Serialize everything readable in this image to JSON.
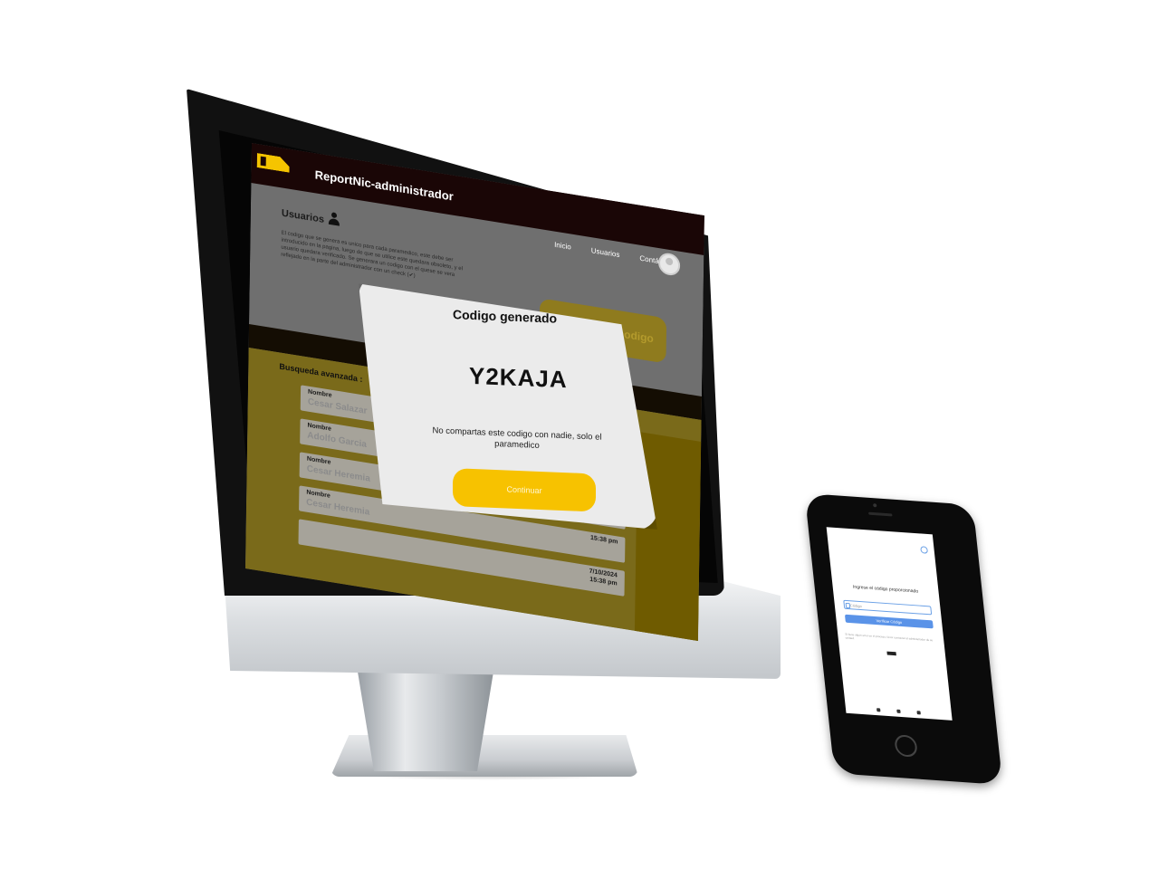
{
  "app": {
    "title": "ReportNic-administrador",
    "nav": [
      "Inicio",
      "Usuarios",
      "Contáctanos"
    ]
  },
  "page": {
    "heading": "Usuarios",
    "info": "El codigo que se genera es unico para cada paramedico, este debe ser introducido en la pagina, luego de que se utilice este quedara obsoleto, y el usuario quedara verificado. Se generara un codigo con el quese se vera reflejado en la parte del administrador con un check (✔)",
    "generate_button": "Generar codigo",
    "search_label": "Busqueda avanzada :"
  },
  "cards": [
    {
      "label": "Nombre",
      "name": "Cesar Salazar",
      "date": "",
      "time": ""
    },
    {
      "label": "Nombre",
      "name": "Adolfo Garcia",
      "date": "",
      "time": ""
    },
    {
      "label": "Nombre",
      "name": "Cesar Heremia",
      "date": "",
      "time": ""
    },
    {
      "label": "Nombre",
      "name": "Cesar Heremia",
      "date": "",
      "time": "15:38 pm"
    },
    {
      "label": "",
      "name": "",
      "date": "7/10/2024",
      "time": "15:38 pm"
    }
  ],
  "modal": {
    "title": "Codigo generado",
    "code": "Y2KAJA",
    "warning": "No compartas este codigo con nadie, solo el paramedico",
    "button": "Continuar"
  },
  "phone": {
    "title": "Ingrese el código proporcionado",
    "input_placeholder": "Código",
    "button": "Verificar Código",
    "note": "Si tiene algún error en el proceso, favor contactar al administrador de su unidad."
  },
  "colors": {
    "accent_yellow": "#F7C200",
    "header_dark": "#1A0606",
    "phone_blue": "#5A93E8"
  }
}
